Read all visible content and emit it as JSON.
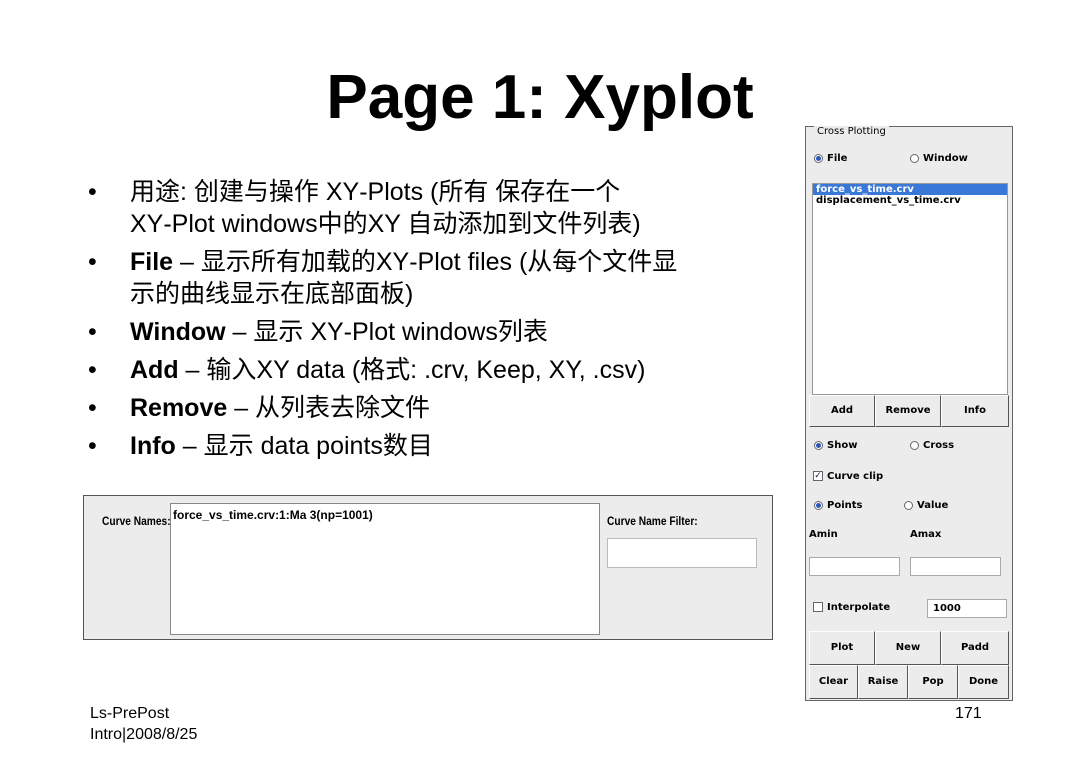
{
  "title": "Page 1: Xyplot",
  "bullets": [
    {
      "bold": "",
      "text": "用途: 创建与操作 XY‐Plots (所有 保存在一个",
      "text2": "XY‐Plot windows中的XY 自动添加到文件列表)"
    },
    {
      "bold": "File",
      "text": " – 显示所有加载的XY‐Plot files (从每个文件显",
      "text2": "示的曲线显示在底部面板)"
    },
    {
      "bold": "Window",
      "text": " – 显示 XY‐Plot windows列表",
      "text2": ""
    },
    {
      "bold": "Add",
      "text": " – 输入XY data (格式: .crv, Keep, XY, .csv)",
      "text2": ""
    },
    {
      "bold": "Remove",
      "text": " – 从列表去除文件",
      "text2": ""
    },
    {
      "bold": "Info",
      "text": " – 显示 data points数目",
      "text2": ""
    }
  ],
  "bullet_symbol": "•",
  "curve_panel": {
    "label": "Curve Names:",
    "entry": "force_vs_time.crv:1:Ma 3(np=1001)",
    "filter_label": "Curve Name Filter:",
    "filter_value": ""
  },
  "cross_plotting": {
    "group_title": "Cross Plotting",
    "file_label": "File",
    "window_label": "Window",
    "source_selected": "File",
    "files": [
      {
        "name": "force_vs_time.crv",
        "selected": true
      },
      {
        "name": "displacement_vs_time.crv",
        "selected": false
      }
    ],
    "add_label": "Add",
    "remove_label": "Remove",
    "info_label": "Info",
    "show_label": "Show",
    "cross_label": "Cross",
    "curve_clip_label": "Curve clip",
    "points_label": "Points",
    "value_label": "Value",
    "amin_label": "Amin",
    "amax_label": "Amax",
    "amin_value": "",
    "amax_value": "",
    "interpolate_label": "Interpolate",
    "interpolate_value": "1000",
    "plot_label": "Plot",
    "new_label": "New",
    "padd_label": "Padd",
    "clear_label": "Clear",
    "raise_label": "Raise",
    "pop_label": "Pop",
    "done_label": "Done"
  },
  "footer": {
    "line1": "Ls-PrePost",
    "line2": "Intro|2008/8/25",
    "page": "171"
  },
  "colors": {
    "selection": "#3a78d8",
    "panel_bg": "#ececec"
  }
}
